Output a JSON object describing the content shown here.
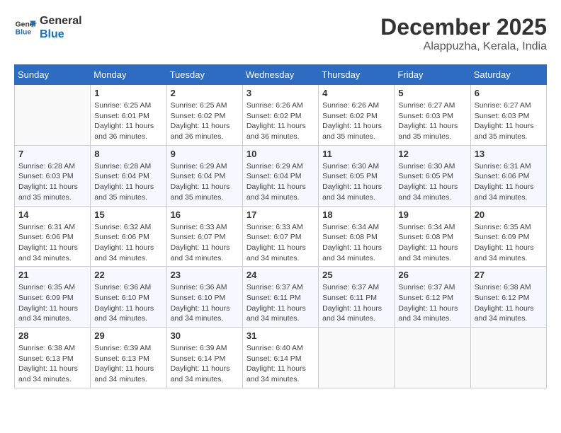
{
  "logo": {
    "line1": "General",
    "line2": "Blue"
  },
  "title": "December 2025",
  "location": "Alappuzha, Kerala, India",
  "days_of_week": [
    "Sunday",
    "Monday",
    "Tuesday",
    "Wednesday",
    "Thursday",
    "Friday",
    "Saturday"
  ],
  "weeks": [
    [
      {
        "day": "",
        "sunrise": "",
        "sunset": "",
        "daylight": ""
      },
      {
        "day": "1",
        "sunrise": "Sunrise: 6:25 AM",
        "sunset": "Sunset: 6:01 PM",
        "daylight": "Daylight: 11 hours and 36 minutes."
      },
      {
        "day": "2",
        "sunrise": "Sunrise: 6:25 AM",
        "sunset": "Sunset: 6:02 PM",
        "daylight": "Daylight: 11 hours and 36 minutes."
      },
      {
        "day": "3",
        "sunrise": "Sunrise: 6:26 AM",
        "sunset": "Sunset: 6:02 PM",
        "daylight": "Daylight: 11 hours and 36 minutes."
      },
      {
        "day": "4",
        "sunrise": "Sunrise: 6:26 AM",
        "sunset": "Sunset: 6:02 PM",
        "daylight": "Daylight: 11 hours and 35 minutes."
      },
      {
        "day": "5",
        "sunrise": "Sunrise: 6:27 AM",
        "sunset": "Sunset: 6:03 PM",
        "daylight": "Daylight: 11 hours and 35 minutes."
      },
      {
        "day": "6",
        "sunrise": "Sunrise: 6:27 AM",
        "sunset": "Sunset: 6:03 PM",
        "daylight": "Daylight: 11 hours and 35 minutes."
      }
    ],
    [
      {
        "day": "7",
        "sunrise": "Sunrise: 6:28 AM",
        "sunset": "Sunset: 6:03 PM",
        "daylight": "Daylight: 11 hours and 35 minutes."
      },
      {
        "day": "8",
        "sunrise": "Sunrise: 6:28 AM",
        "sunset": "Sunset: 6:04 PM",
        "daylight": "Daylight: 11 hours and 35 minutes."
      },
      {
        "day": "9",
        "sunrise": "Sunrise: 6:29 AM",
        "sunset": "Sunset: 6:04 PM",
        "daylight": "Daylight: 11 hours and 35 minutes."
      },
      {
        "day": "10",
        "sunrise": "Sunrise: 6:29 AM",
        "sunset": "Sunset: 6:04 PM",
        "daylight": "Daylight: 11 hours and 34 minutes."
      },
      {
        "day": "11",
        "sunrise": "Sunrise: 6:30 AM",
        "sunset": "Sunset: 6:05 PM",
        "daylight": "Daylight: 11 hours and 34 minutes."
      },
      {
        "day": "12",
        "sunrise": "Sunrise: 6:30 AM",
        "sunset": "Sunset: 6:05 PM",
        "daylight": "Daylight: 11 hours and 34 minutes."
      },
      {
        "day": "13",
        "sunrise": "Sunrise: 6:31 AM",
        "sunset": "Sunset: 6:06 PM",
        "daylight": "Daylight: 11 hours and 34 minutes."
      }
    ],
    [
      {
        "day": "14",
        "sunrise": "Sunrise: 6:31 AM",
        "sunset": "Sunset: 6:06 PM",
        "daylight": "Daylight: 11 hours and 34 minutes."
      },
      {
        "day": "15",
        "sunrise": "Sunrise: 6:32 AM",
        "sunset": "Sunset: 6:06 PM",
        "daylight": "Daylight: 11 hours and 34 minutes."
      },
      {
        "day": "16",
        "sunrise": "Sunrise: 6:33 AM",
        "sunset": "Sunset: 6:07 PM",
        "daylight": "Daylight: 11 hours and 34 minutes."
      },
      {
        "day": "17",
        "sunrise": "Sunrise: 6:33 AM",
        "sunset": "Sunset: 6:07 PM",
        "daylight": "Daylight: 11 hours and 34 minutes."
      },
      {
        "day": "18",
        "sunrise": "Sunrise: 6:34 AM",
        "sunset": "Sunset: 6:08 PM",
        "daylight": "Daylight: 11 hours and 34 minutes."
      },
      {
        "day": "19",
        "sunrise": "Sunrise: 6:34 AM",
        "sunset": "Sunset: 6:08 PM",
        "daylight": "Daylight: 11 hours and 34 minutes."
      },
      {
        "day": "20",
        "sunrise": "Sunrise: 6:35 AM",
        "sunset": "Sunset: 6:09 PM",
        "daylight": "Daylight: 11 hours and 34 minutes."
      }
    ],
    [
      {
        "day": "21",
        "sunrise": "Sunrise: 6:35 AM",
        "sunset": "Sunset: 6:09 PM",
        "daylight": "Daylight: 11 hours and 34 minutes."
      },
      {
        "day": "22",
        "sunrise": "Sunrise: 6:36 AM",
        "sunset": "Sunset: 6:10 PM",
        "daylight": "Daylight: 11 hours and 34 minutes."
      },
      {
        "day": "23",
        "sunrise": "Sunrise: 6:36 AM",
        "sunset": "Sunset: 6:10 PM",
        "daylight": "Daylight: 11 hours and 34 minutes."
      },
      {
        "day": "24",
        "sunrise": "Sunrise: 6:37 AM",
        "sunset": "Sunset: 6:11 PM",
        "daylight": "Daylight: 11 hours and 34 minutes."
      },
      {
        "day": "25",
        "sunrise": "Sunrise: 6:37 AM",
        "sunset": "Sunset: 6:11 PM",
        "daylight": "Daylight: 11 hours and 34 minutes."
      },
      {
        "day": "26",
        "sunrise": "Sunrise: 6:37 AM",
        "sunset": "Sunset: 6:12 PM",
        "daylight": "Daylight: 11 hours and 34 minutes."
      },
      {
        "day": "27",
        "sunrise": "Sunrise: 6:38 AM",
        "sunset": "Sunset: 6:12 PM",
        "daylight": "Daylight: 11 hours and 34 minutes."
      }
    ],
    [
      {
        "day": "28",
        "sunrise": "Sunrise: 6:38 AM",
        "sunset": "Sunset: 6:13 PM",
        "daylight": "Daylight: 11 hours and 34 minutes."
      },
      {
        "day": "29",
        "sunrise": "Sunrise: 6:39 AM",
        "sunset": "Sunset: 6:13 PM",
        "daylight": "Daylight: 11 hours and 34 minutes."
      },
      {
        "day": "30",
        "sunrise": "Sunrise: 6:39 AM",
        "sunset": "Sunset: 6:14 PM",
        "daylight": "Daylight: 11 hours and 34 minutes."
      },
      {
        "day": "31",
        "sunrise": "Sunrise: 6:40 AM",
        "sunset": "Sunset: 6:14 PM",
        "daylight": "Daylight: 11 hours and 34 minutes."
      },
      {
        "day": "",
        "sunrise": "",
        "sunset": "",
        "daylight": ""
      },
      {
        "day": "",
        "sunrise": "",
        "sunset": "",
        "daylight": ""
      },
      {
        "day": "",
        "sunrise": "",
        "sunset": "",
        "daylight": ""
      }
    ]
  ]
}
